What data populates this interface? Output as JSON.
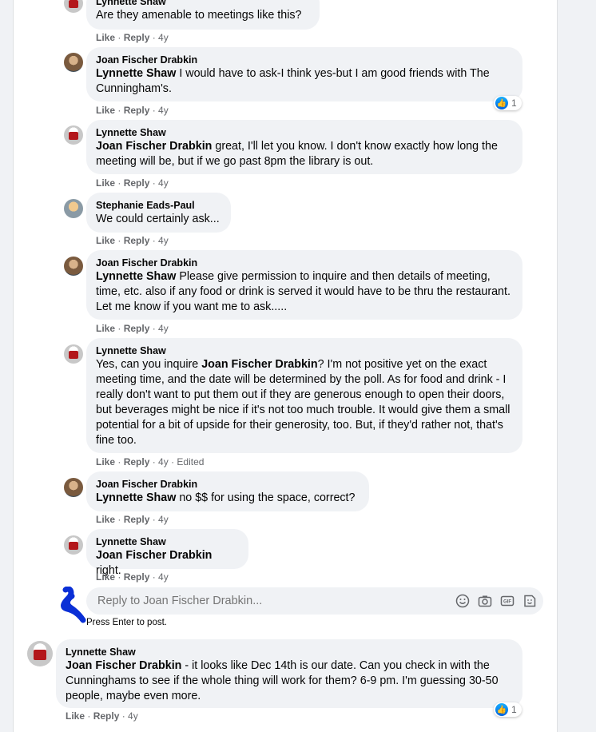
{
  "comments": [
    {
      "author": "Lynnette Shaw",
      "mention": "",
      "text": "Are they amenable to meetings like this?",
      "like": "Like",
      "reply": "Reply",
      "time": "4y",
      "extra": ""
    },
    {
      "author": "Joan Fischer Drabkin",
      "mention": "Lynnette Shaw",
      "text": " I would have to ask-I think yes-but I am good friends with The Cunningham's.",
      "like": "Like",
      "reply": "Reply",
      "time": "4y",
      "extra": "",
      "reactions": "1"
    },
    {
      "author": "Lynnette Shaw",
      "mention": "Joan Fischer Drabkin",
      "text": " great, I'll let you know. I don't know exactly how long the meeting will be, but if we go past 8pm the library is out.",
      "like": "Like",
      "reply": "Reply",
      "time": "4y",
      "extra": ""
    },
    {
      "author": "Stephanie Eads-Paul",
      "mention": "",
      "text": "We could certainly ask...",
      "like": "Like",
      "reply": "Reply",
      "time": "4y",
      "extra": ""
    },
    {
      "author": "Joan Fischer Drabkin",
      "mention": "Lynnette Shaw",
      "text": " Please give permission to inquire and then details of meeting, time, etc. also if any food or drink is served it would have to be thru the restaurant. Let me know if you want me to ask.....",
      "like": "Like",
      "reply": "Reply",
      "time": "4y",
      "extra": ""
    },
    {
      "author": "Lynnette Shaw",
      "pre": "Yes, can you inquire ",
      "mention": "Joan Fischer Drabkin",
      "text": "? I'm not positive yet on the exact meeting time, and the date will be determined by the poll. As for food and drink - I really don't want to put them out if they are generous enough to open their doors, but beverages might be nice if it's not too much trouble. It would give them a small potential for a bit of upside for their generosity, too. But, if they'd rather not, that's fine too.",
      "like": "Like",
      "reply": "Reply",
      "time": "4y",
      "extra": "Edited"
    },
    {
      "author": "Joan Fischer Drabkin",
      "mention": "Lynnette Shaw",
      "text": " no $$ for using the space, correct?",
      "like": "Like",
      "reply": "Reply",
      "time": "4y",
      "extra": ""
    },
    {
      "author": "Lynnette Shaw",
      "mention": "Joan Fischer Drabkin",
      "text": " right.",
      "like": "Like",
      "reply": "Reply",
      "time": "4y",
      "extra": ""
    }
  ],
  "reply_box": {
    "placeholder": "Reply to Joan Fischer Drabkin...",
    "hint": "Press Enter to post."
  },
  "top_comment": {
    "author": "Lynnette Shaw",
    "mention": "Joan Fischer Drabkin",
    "text": " - it looks like Dec 14th is our date. Can you check in with the Cunninghams to see if the whole thing will work for them? 6-9 pm. I'm guessing 30-50 people, maybe even more.",
    "like": "Like",
    "reply": "Reply",
    "time": "4y",
    "reactions": "1"
  },
  "colors": {
    "like_blue": "#0866ff",
    "bubble": "#f0f2f5",
    "meta": "#65676b",
    "scribble": "#0a2fd6"
  }
}
